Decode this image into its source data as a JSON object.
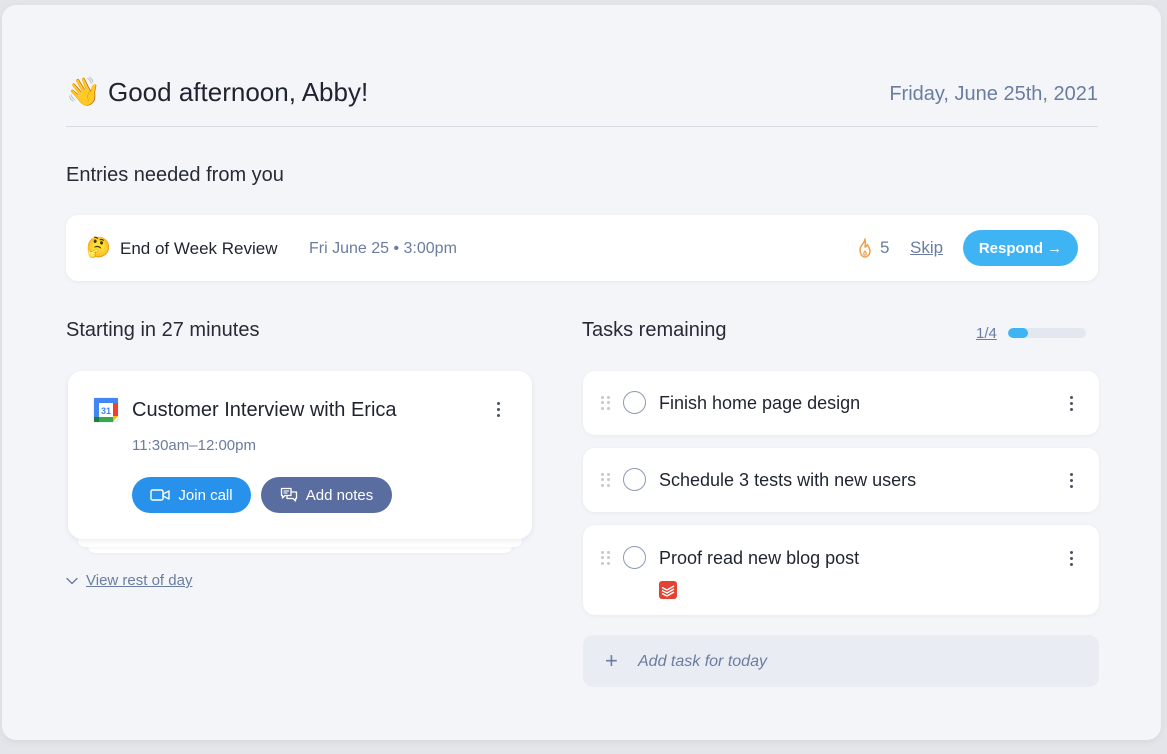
{
  "header": {
    "wave_emoji": "👋",
    "greeting": "Good afternoon, Abby!",
    "date": "Friday, June 25th, 2021"
  },
  "entries": {
    "section_title": "Entries needed from you",
    "item": {
      "emoji": "🤔",
      "title": "End of Week Review",
      "time": "Fri June 25 • 3:00pm",
      "streak_count": "5",
      "skip_label": "Skip",
      "respond_label": "Respond →"
    }
  },
  "upcoming": {
    "section_title": "Starting in 27 minutes",
    "meeting": {
      "calendar_day": "31",
      "title": "Customer Interview with Erica",
      "time": "11:30am–12:00pm",
      "join_label": "Join call",
      "notes_label": "Add notes"
    },
    "view_rest_label": "View rest of day"
  },
  "tasks": {
    "section_title": "Tasks remaining",
    "count_label": "1/4",
    "progress_fraction": 0.25,
    "items": [
      {
        "label": "Finish home page design"
      },
      {
        "label": "Schedule 3 tests with new users"
      },
      {
        "label": "Proof read new blog post",
        "integration_icon": "todoist-icon"
      }
    ],
    "add_placeholder": "Add task for today"
  },
  "colors": {
    "accent": "#3eb4f5",
    "join_button": "#2891ec",
    "notes_button": "#5a6da0",
    "muted_text": "#6a7da0"
  }
}
